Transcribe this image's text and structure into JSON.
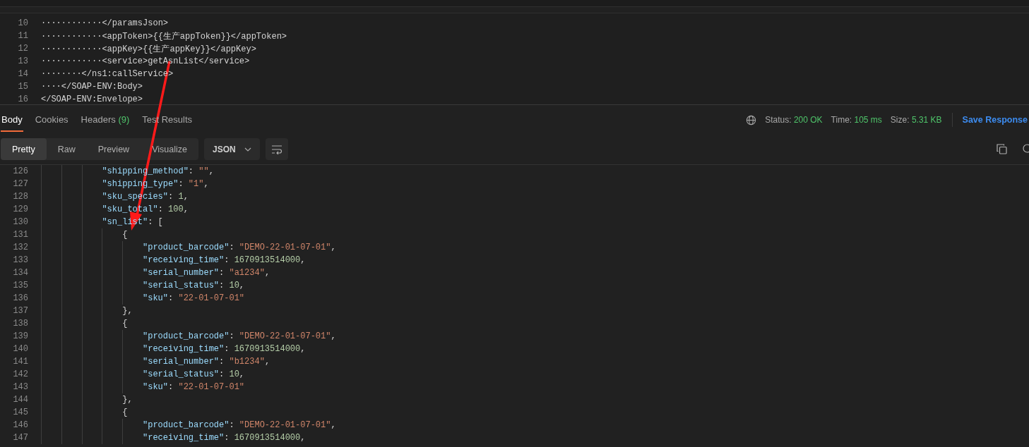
{
  "request_editor": {
    "lines": [
      {
        "number": "10",
        "text": "············</paramsJson>"
      },
      {
        "number": "11",
        "text": "············<appToken>{{生产appToken}}</appToken>"
      },
      {
        "number": "12",
        "text": "············<appKey>{{生产appKey}}</appKey>"
      },
      {
        "number": "13",
        "text": "············<service>getAsnList</service>"
      },
      {
        "number": "14",
        "text": "········</ns1:callService>"
      },
      {
        "number": "15",
        "text": "····</SOAP-ENV:Body>"
      },
      {
        "number": "16",
        "text": "</SOAP-ENV:Envelope>"
      }
    ]
  },
  "response_tabs": [
    {
      "label": "Body",
      "selected": true
    },
    {
      "label": "Cookies",
      "selected": false
    },
    {
      "label": "Headers",
      "count": "(9)",
      "selected": false
    },
    {
      "label": "Test Results",
      "selected": false
    }
  ],
  "response_meta": [
    {
      "label": "Status:",
      "value": "200 OK"
    },
    {
      "label": "Time:",
      "value": "105 ms"
    },
    {
      "label": "Size:",
      "value": "5.31 KB"
    }
  ],
  "save_response": "Save Response",
  "view_modes": [
    {
      "label": "Pretty",
      "selected": true
    },
    {
      "label": "Raw",
      "selected": false
    },
    {
      "label": "Preview",
      "selected": false
    },
    {
      "label": "Visualize",
      "selected": false
    }
  ],
  "format_select": "JSON",
  "response_body": {
    "lines": [
      {
        "number": "126",
        "tokens": [
          {
            "kind": "key",
            "text": "\"shipping_method\""
          },
          {
            "kind": "punct",
            "text": ": "
          },
          {
            "kind": "string",
            "text": "\"\""
          },
          {
            "kind": "punct",
            "text": ","
          }
        ]
      },
      {
        "number": "127",
        "tokens": [
          {
            "kind": "key",
            "text": "\"shipping_type\""
          },
          {
            "kind": "punct",
            "text": ": "
          },
          {
            "kind": "string",
            "text": "\"1\""
          },
          {
            "kind": "punct",
            "text": ","
          }
        ]
      },
      {
        "number": "128",
        "tokens": [
          {
            "kind": "key",
            "text": "\"sku_species\""
          },
          {
            "kind": "punct",
            "text": ": "
          },
          {
            "kind": "number",
            "text": "1"
          },
          {
            "kind": "punct",
            "text": ","
          }
        ]
      },
      {
        "number": "129",
        "tokens": [
          {
            "kind": "key",
            "text": "\"sku_total\""
          },
          {
            "kind": "punct",
            "text": ": "
          },
          {
            "kind": "number",
            "text": "100"
          },
          {
            "kind": "punct",
            "text": ","
          }
        ]
      },
      {
        "number": "130",
        "tokens": [
          {
            "kind": "key",
            "text": "\"sn_list\""
          },
          {
            "kind": "punct",
            "text": ": ["
          }
        ],
        "children": [
          {
            "number": "131",
            "tokens": [
              {
                "kind": "punct",
                "text": "{"
              }
            ],
            "children": [
              {
                "number": "132",
                "tokens": [
                  {
                    "kind": "key",
                    "text": "\"product_barcode\""
                  },
                  {
                    "kind": "punct",
                    "text": ": "
                  },
                  {
                    "kind": "string",
                    "text": "\"DEMO-22-01-07-01\""
                  },
                  {
                    "kind": "punct",
                    "text": ","
                  }
                ]
              },
              {
                "number": "133",
                "tokens": [
                  {
                    "kind": "key",
                    "text": "\"receiving_time\""
                  },
                  {
                    "kind": "punct",
                    "text": ": "
                  },
                  {
                    "kind": "number",
                    "text": "1670913514000"
                  },
                  {
                    "kind": "punct",
                    "text": ","
                  }
                ]
              },
              {
                "number": "134",
                "tokens": [
                  {
                    "kind": "key",
                    "text": "\"serial_number\""
                  },
                  {
                    "kind": "punct",
                    "text": ": "
                  },
                  {
                    "kind": "string",
                    "text": "\"a1234\""
                  },
                  {
                    "kind": "punct",
                    "text": ","
                  }
                ]
              },
              {
                "number": "135",
                "tokens": [
                  {
                    "kind": "key",
                    "text": "\"serial_status\""
                  },
                  {
                    "kind": "punct",
                    "text": ": "
                  },
                  {
                    "kind": "number",
                    "text": "10"
                  },
                  {
                    "kind": "punct",
                    "text": ","
                  }
                ]
              },
              {
                "number": "136",
                "tokens": [
                  {
                    "kind": "key",
                    "text": "\"sku\""
                  },
                  {
                    "kind": "punct",
                    "text": ": "
                  },
                  {
                    "kind": "string",
                    "text": "\"22-01-07-01\""
                  }
                ]
              }
            ]
          },
          {
            "number": "137",
            "tokens": [
              {
                "kind": "punct",
                "text": "},"
              }
            ]
          },
          {
            "number": "138",
            "tokens": [
              {
                "kind": "punct",
                "text": "{"
              }
            ],
            "children": [
              {
                "number": "139",
                "tokens": [
                  {
                    "kind": "key",
                    "text": "\"product_barcode\""
                  },
                  {
                    "kind": "punct",
                    "text": ": "
                  },
                  {
                    "kind": "string",
                    "text": "\"DEMO-22-01-07-01\""
                  },
                  {
                    "kind": "punct",
                    "text": ","
                  }
                ]
              },
              {
                "number": "140",
                "tokens": [
                  {
                    "kind": "key",
                    "text": "\"receiving_time\""
                  },
                  {
                    "kind": "punct",
                    "text": ": "
                  },
                  {
                    "kind": "number",
                    "text": "1670913514000"
                  },
                  {
                    "kind": "punct",
                    "text": ","
                  }
                ]
              },
              {
                "number": "141",
                "tokens": [
                  {
                    "kind": "key",
                    "text": "\"serial_number\""
                  },
                  {
                    "kind": "punct",
                    "text": ": "
                  },
                  {
                    "kind": "string",
                    "text": "\"b1234\""
                  },
                  {
                    "kind": "punct",
                    "text": ","
                  }
                ]
              },
              {
                "number": "142",
                "tokens": [
                  {
                    "kind": "key",
                    "text": "\"serial_status\""
                  },
                  {
                    "kind": "punct",
                    "text": ": "
                  },
                  {
                    "kind": "number",
                    "text": "10"
                  },
                  {
                    "kind": "punct",
                    "text": ","
                  }
                ]
              },
              {
                "number": "143",
                "tokens": [
                  {
                    "kind": "key",
                    "text": "\"sku\""
                  },
                  {
                    "kind": "punct",
                    "text": ": "
                  },
                  {
                    "kind": "string",
                    "text": "\"22-01-07-01\""
                  }
                ]
              }
            ]
          },
          {
            "number": "144",
            "tokens": [
              {
                "kind": "punct",
                "text": "},"
              }
            ]
          },
          {
            "number": "145",
            "tokens": [
              {
                "kind": "punct",
                "text": "{"
              }
            ],
            "children": [
              {
                "number": "146",
                "tokens": [
                  {
                    "kind": "key",
                    "text": "\"product_barcode\""
                  },
                  {
                    "kind": "punct",
                    "text": ": "
                  },
                  {
                    "kind": "string",
                    "text": "\"DEMO-22-01-07-01\""
                  },
                  {
                    "kind": "punct",
                    "text": ","
                  }
                ]
              },
              {
                "number": "147",
                "tokens": [
                  {
                    "kind": "key",
                    "text": "\"receiving_time\""
                  },
                  {
                    "kind": "punct",
                    "text": ": "
                  },
                  {
                    "kind": "number",
                    "text": "1670913514000"
                  },
                  {
                    "kind": "punct",
                    "text": ","
                  }
                ]
              }
            ]
          }
        ]
      }
    ]
  }
}
